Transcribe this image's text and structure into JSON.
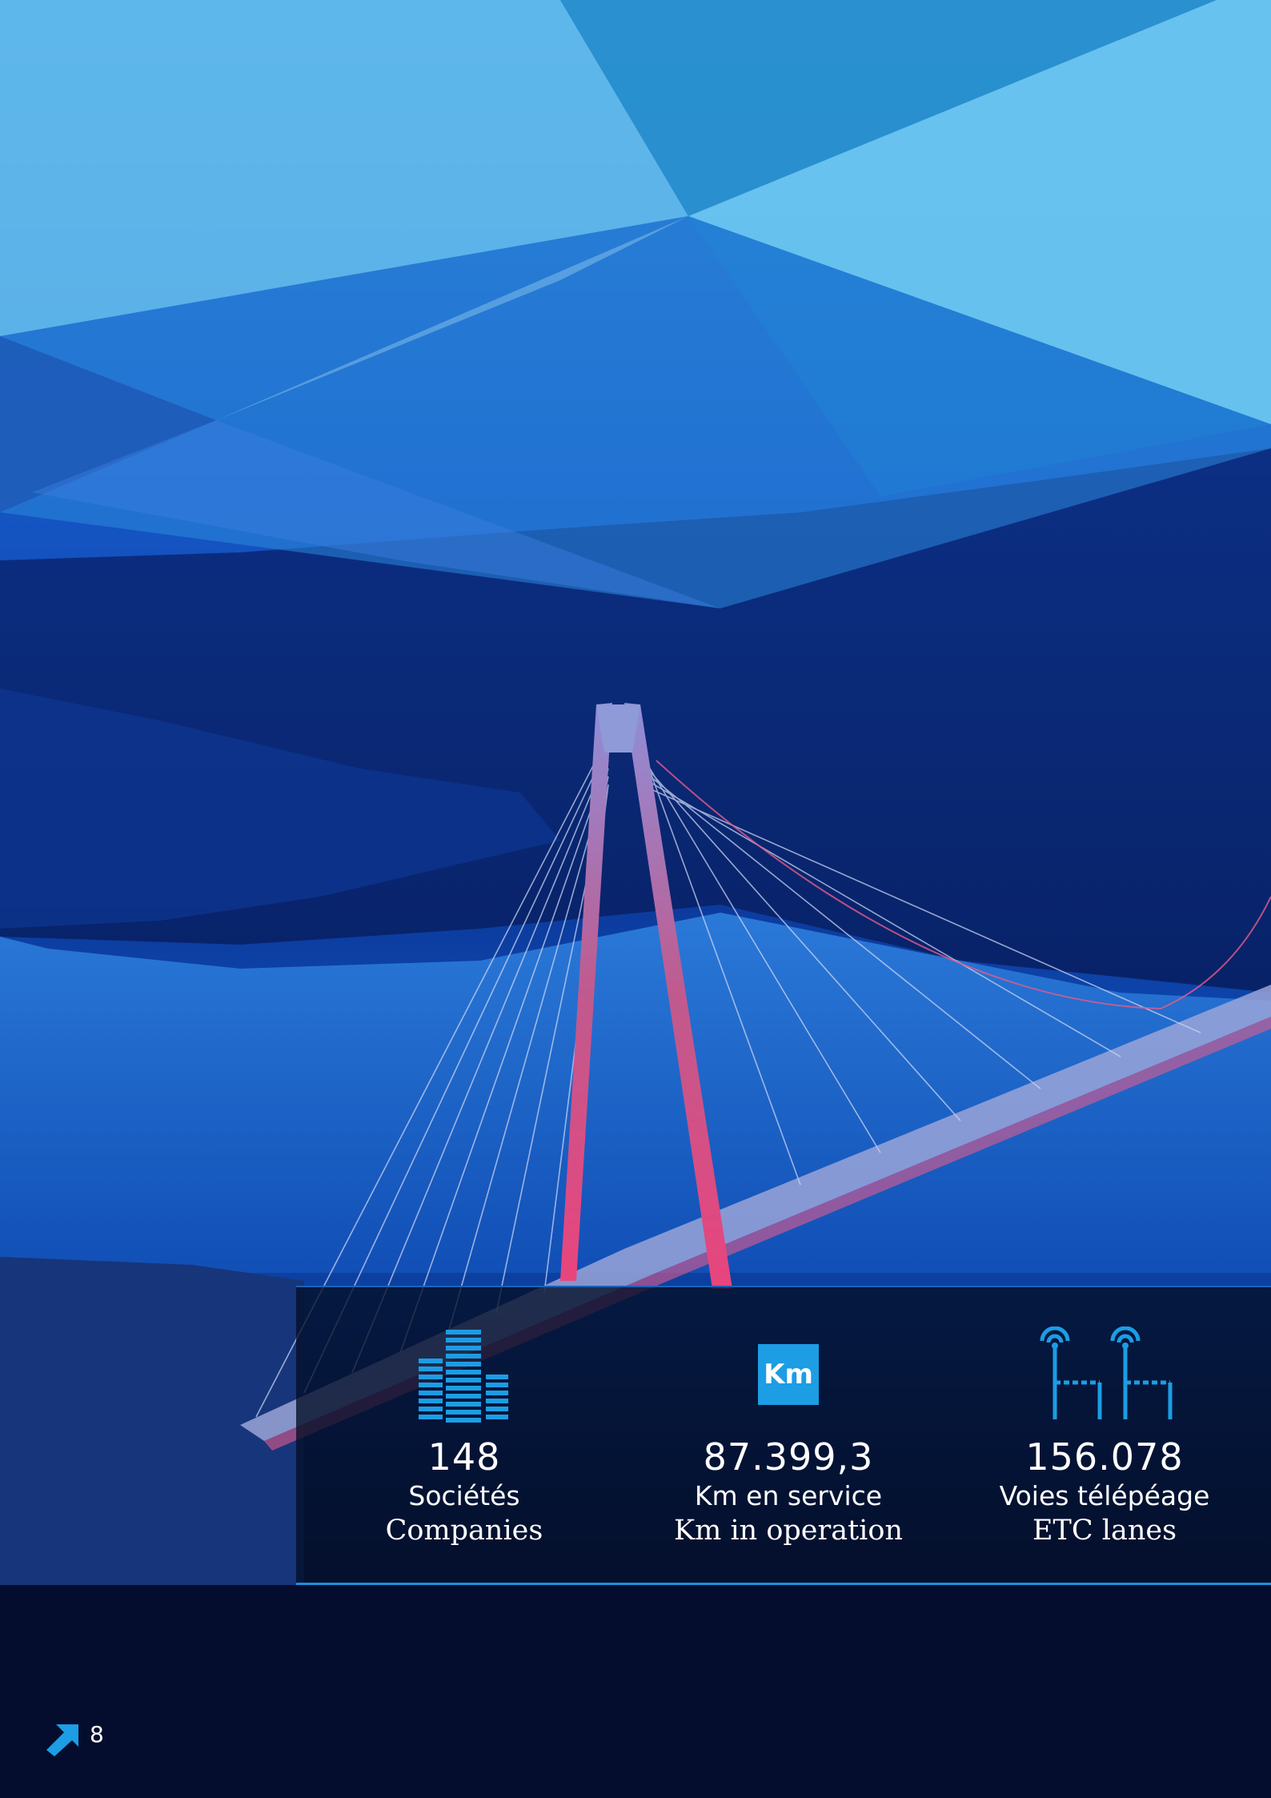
{
  "stats": [
    {
      "icon": "buildings-icon",
      "value": "148",
      "label_fr": "Sociétés",
      "label_en": "Companies"
    },
    {
      "icon": "km-icon",
      "badge": "Km",
      "value": "87.399,3",
      "label_fr": "Km en service",
      "label_en": "Km in operation"
    },
    {
      "icon": "toll-gantry-icon",
      "value": "156.078",
      "label_fr": "Voies télépéage",
      "label_en": "ETC lanes"
    }
  ],
  "footer": {
    "icon": "arrow-up-right-icon",
    "page_number": "8"
  },
  "colors": {
    "accent": "#1c9de4",
    "panel": "#040e26",
    "sky_light": "#6cc6f0"
  }
}
